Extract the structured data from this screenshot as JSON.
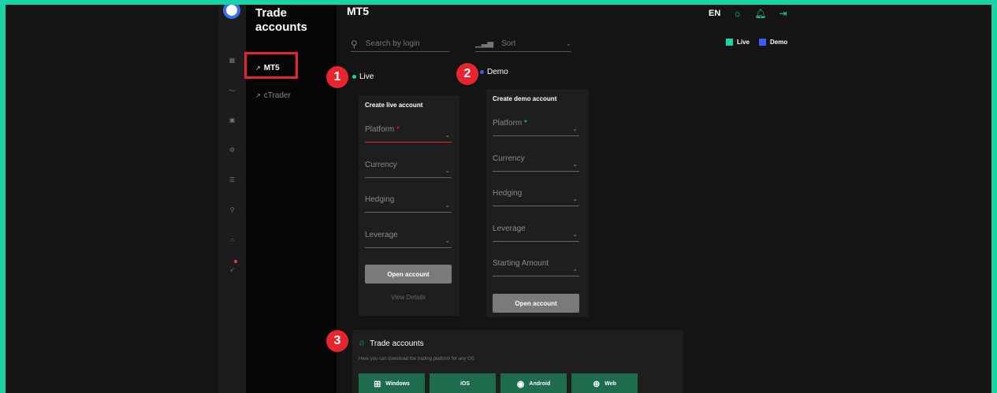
{
  "sidebar": {
    "icons": [
      "grid-icon",
      "chart-icon",
      "wallet-icon",
      "cycle-icon",
      "list-icon",
      "user-icon",
      "chat-icon",
      "rocket-icon"
    ]
  },
  "subnav": {
    "title_line1": "Trade",
    "title_line2": "accounts",
    "items": [
      {
        "label": "MT5",
        "active": true
      },
      {
        "label": "cTrader",
        "active": false
      }
    ]
  },
  "header": {
    "page_title": "MT5",
    "lang": "EN",
    "search_placeholder": "Search by login",
    "sort_label": "Sort"
  },
  "legend": {
    "live_label": "Live",
    "demo_label": "Demo",
    "live_color": "#1bd4a6",
    "demo_color": "#3b5bf2"
  },
  "annotations": {
    "badge1": "1",
    "badge2": "2",
    "badge3": "3"
  },
  "live": {
    "section_label": "Live",
    "card_title": "Create live account",
    "fields": [
      {
        "label": "Platform",
        "required": "*"
      },
      {
        "label": "Currency"
      },
      {
        "label": "Hedging"
      },
      {
        "label": "Leverage"
      }
    ],
    "open_button": "Open account",
    "view_details": "View Details"
  },
  "demo": {
    "section_label": "Demo",
    "card_title": "Create demo account",
    "fields": [
      {
        "label": "Platform",
        "required": "*"
      },
      {
        "label": "Currency"
      },
      {
        "label": "Hedging"
      },
      {
        "label": "Leverage"
      },
      {
        "label": "Starting Amount"
      }
    ],
    "open_button": "Open account"
  },
  "trade_accounts": {
    "title": "Trade accounts",
    "subtitle": "Here you can download the trading platform for any OS",
    "os_buttons": [
      {
        "label": "Windows",
        "icon": "windows-icon"
      },
      {
        "label": "iOS",
        "icon": "apple-icon"
      },
      {
        "label": "Android",
        "icon": "android-icon"
      },
      {
        "label": "Web",
        "icon": "globe-icon"
      }
    ]
  }
}
